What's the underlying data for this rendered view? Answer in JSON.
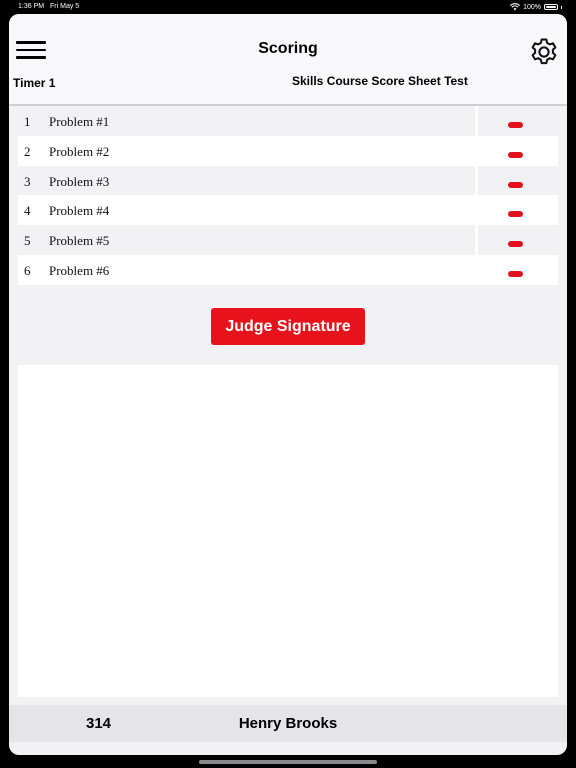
{
  "status_bar": {
    "time": "1:36 PM",
    "date": "Fri May 5",
    "battery": "100%",
    "icons": [
      "wifi-icon",
      "battery-icon"
    ]
  },
  "nav": {
    "title": "Scoring",
    "menu_icon": "hamburger-menu-icon",
    "settings_icon": "gear-icon"
  },
  "header": {
    "timer_label": "Timer 1",
    "sheet_title": "Skills Course Score Sheet Test"
  },
  "problems": [
    {
      "number": "1",
      "label": "Problem #1",
      "status_color": "#e3101e"
    },
    {
      "number": "2",
      "label": "Problem #2",
      "status_color": "#e3101e"
    },
    {
      "number": "3",
      "label": "Problem #3",
      "status_color": "#e3101e"
    },
    {
      "number": "4",
      "label": "Problem #4",
      "status_color": "#e3101e"
    },
    {
      "number": "5",
      "label": "Problem #5",
      "status_color": "#e3101e"
    },
    {
      "number": "6",
      "label": "Problem #6",
      "status_color": "#e3101e"
    }
  ],
  "signature": {
    "button_label": "Judge Signature",
    "button_color": "#e8121c"
  },
  "footer": {
    "competitor_number": "314",
    "competitor_name": "Henry Brooks"
  }
}
